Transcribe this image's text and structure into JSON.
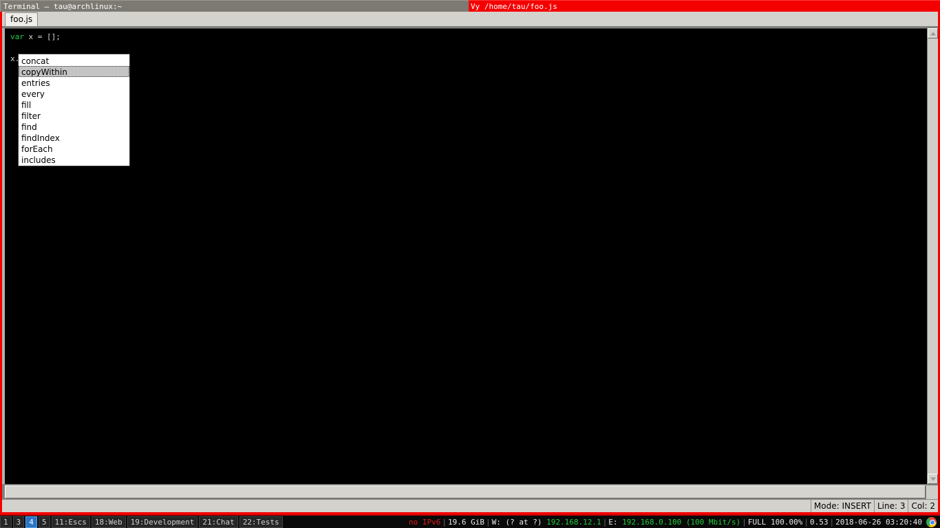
{
  "titlebar": {
    "left_title": "Terminal — tau@archlinux:~",
    "right_title": "Vy /home/tau/foo.js",
    "accent_red": "#f40000",
    "left_bg": "#7c7a72"
  },
  "tabs": [
    {
      "label": "foo.js",
      "active": true
    }
  ],
  "editor": {
    "lines": [
      {
        "n": 1,
        "tokens": [
          {
            "text": "var",
            "kind": "keyword"
          },
          {
            "text": " x = [];",
            "kind": "plain"
          }
        ]
      },
      {
        "n": 2,
        "tokens": []
      },
      {
        "n": 3,
        "tokens": [
          {
            "text": "x.",
            "kind": "plain"
          }
        ]
      }
    ],
    "line1_keyword": "var",
    "line1_rest": " x = [];",
    "line3_text": "x.",
    "keyword_color": "#23d04a",
    "text_color": "#d8d8d8",
    "background": "#000000"
  },
  "autocomplete": {
    "items": [
      "concat",
      "copyWithin",
      "entries",
      "every",
      "fill",
      "filter",
      "find",
      "findIndex",
      "forEach",
      "includes"
    ],
    "selected_index": 1,
    "selected_label": "copyWithin",
    "background": "#ffffff",
    "selected_background": "#c4c4c4"
  },
  "scrollbar": {
    "up_arrow": "scroll-up-arrow",
    "down_arrow": "scroll-down-arrow"
  },
  "statusbar": {
    "mode": "Mode: INSERT",
    "line": "Line: 3",
    "col": "Col: 2"
  },
  "taskbar": {
    "workspaces": [
      {
        "label": "1",
        "active": false
      },
      {
        "label": "3",
        "active": false
      },
      {
        "label": "4",
        "active": true
      },
      {
        "label": "5",
        "active": false
      },
      {
        "label": "11:Escs",
        "active": false
      },
      {
        "label": "18:Web",
        "active": false
      },
      {
        "label": "19:Development",
        "active": false
      },
      {
        "label": "21:Chat",
        "active": false
      },
      {
        "label": "22:Tests",
        "active": false
      }
    ],
    "tray": {
      "ipv6": "no IPv6",
      "disk": "19.6 GiB",
      "wifi_label": "W: (? at ?)",
      "wifi_ip": "192.168.12.1",
      "eth_label": "E:",
      "eth_ip": "192.168.0.100",
      "eth_speed": "(100 Mbit/s)",
      "battery": "FULL 100.00%",
      "load": "0.53",
      "datetime": "2018-06-26 03:20:40",
      "sep": "|"
    },
    "active_color": "#2a74c6",
    "red_color": "#e01b1b",
    "green_color": "#1fcc3c"
  }
}
